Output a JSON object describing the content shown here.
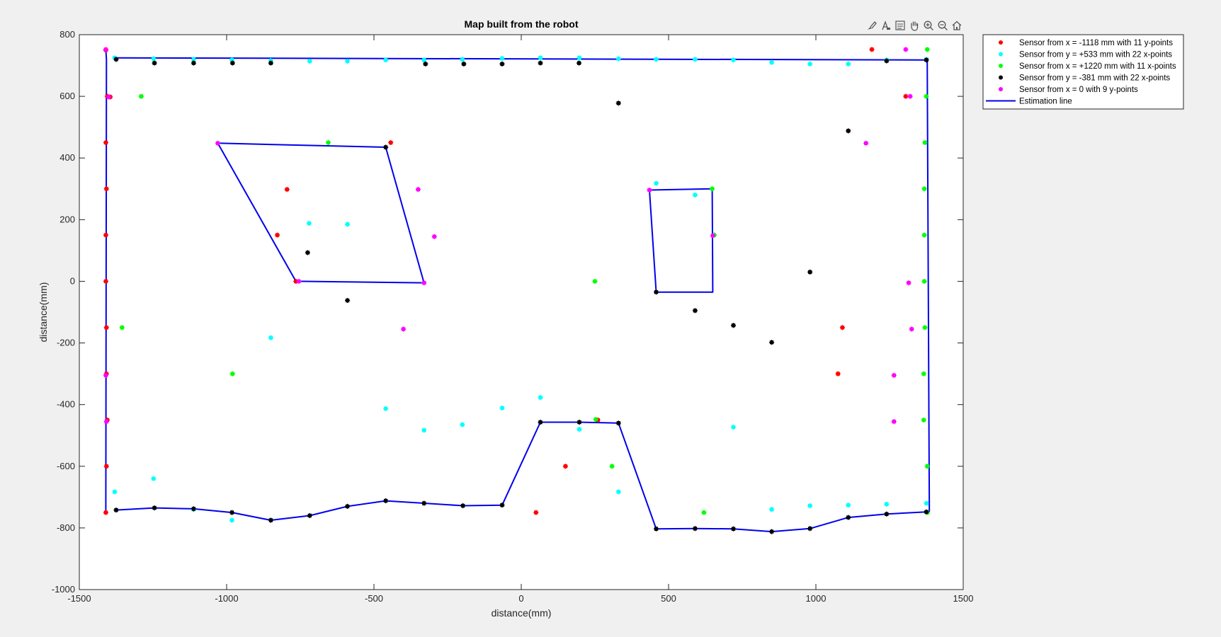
{
  "chart_data": {
    "type": "scatter",
    "title": "Map built from the robot",
    "xlabel": "distance(mm)",
    "ylabel": "distance(mm)",
    "xlim": [
      -1500,
      1500
    ],
    "ylim": [
      -1000,
      800
    ],
    "xticks": [
      -1500,
      -1000,
      -500,
      0,
      500,
      1000,
      1500
    ],
    "yticks": [
      -1000,
      -800,
      -600,
      -400,
      -200,
      0,
      200,
      400,
      600,
      800
    ],
    "xticklabels": [
      "-1500",
      "-1000",
      "-500",
      "0",
      "500",
      "1000",
      "1500"
    ],
    "yticklabels": [
      "-1000",
      "-800",
      "-600",
      "-400",
      "-200",
      "0",
      "200",
      "400",
      "600",
      "800"
    ],
    "grid": false,
    "legend_position": "outside-top-right",
    "series": [
      {
        "name": "Sensor from x = -1118 mm with 11 y-points",
        "kind": "scatter",
        "color": "#ff0000",
        "points": [
          [
            -1410,
            750
          ],
          [
            -1405,
            600
          ],
          [
            -1410,
            450
          ],
          [
            -1408,
            300
          ],
          [
            -1410,
            150
          ],
          [
            -1410,
            0
          ],
          [
            -1408,
            -150
          ],
          [
            -1408,
            -300
          ],
          [
            -1405,
            -450
          ],
          [
            -1408,
            -600
          ],
          [
            -1410,
            -750
          ],
          [
            -795,
            298
          ],
          [
            -828,
            150
          ],
          [
            -765,
            0
          ],
          [
            -443,
            450
          ],
          [
            -1395,
            598
          ],
          [
            1190,
            752
          ],
          [
            1305,
            600
          ],
          [
            1090,
            -150
          ],
          [
            1075,
            -300
          ],
          [
            260,
            -450
          ],
          [
            150,
            -600
          ],
          [
            50,
            -750
          ]
        ]
      },
      {
        "name": "Sensor from y = +533 mm with 22 x-points",
        "kind": "scatter",
        "color": "#00ffff",
        "points": [
          [
            -1380,
            725
          ],
          [
            -1248,
            722
          ],
          [
            -1112,
            720
          ],
          [
            -982,
            718
          ],
          [
            -850,
            716
          ],
          [
            -718,
            714
          ],
          [
            -590,
            714
          ],
          [
            -460,
            718
          ],
          [
            -330,
            718
          ],
          [
            -200,
            720
          ],
          [
            -65,
            723
          ],
          [
            65,
            725
          ],
          [
            197,
            725
          ],
          [
            330,
            722
          ],
          [
            458,
            720
          ],
          [
            590,
            720
          ],
          [
            720,
            718
          ],
          [
            850,
            710
          ],
          [
            980,
            705
          ],
          [
            1110,
            705
          ],
          [
            1240,
            718
          ],
          [
            1375,
            720
          ],
          [
            -720,
            188
          ],
          [
            -590,
            185
          ],
          [
            -850,
            -183
          ],
          [
            -460,
            -413
          ],
          [
            -330,
            -483
          ],
          [
            -200,
            -465
          ],
          [
            -65,
            -411
          ],
          [
            65,
            -377
          ],
          [
            197,
            -480
          ],
          [
            330,
            -683
          ],
          [
            458,
            318
          ],
          [
            590,
            280
          ],
          [
            720,
            -473
          ],
          [
            850,
            -740
          ],
          [
            980,
            -728
          ],
          [
            1110,
            -726
          ],
          [
            1240,
            -723
          ],
          [
            1375,
            -720
          ],
          [
            -1380,
            -683
          ],
          [
            -1248,
            -640
          ],
          [
            -1112,
            -740
          ],
          [
            -982,
            -775
          ]
        ]
      },
      {
        "name": "Sensor from x = +1220 mm with 11 x-points",
        "kind": "scatter",
        "color": "#00ff00",
        "points": [
          [
            1378,
            752
          ],
          [
            1375,
            600
          ],
          [
            1370,
            450
          ],
          [
            1368,
            300
          ],
          [
            1368,
            150
          ],
          [
            1368,
            0
          ],
          [
            1370,
            -150
          ],
          [
            1366,
            -300
          ],
          [
            1366,
            -450
          ],
          [
            1378,
            -600
          ],
          [
            1378,
            -750
          ],
          [
            -1290,
            600
          ],
          [
            -1355,
            -150
          ],
          [
            -980,
            -300
          ],
          [
            -655,
            450
          ],
          [
            250,
            0
          ],
          [
            655,
            150
          ],
          [
            648,
            300
          ],
          [
            308,
            -600
          ],
          [
            620,
            -750
          ],
          [
            253,
            -448
          ]
        ]
      },
      {
        "name": "Sensor from y = -381 mm with 22 x-points",
        "kind": "scatter",
        "color": "#000000",
        "points": [
          [
            -1375,
            720
          ],
          [
            -1245,
            708
          ],
          [
            -1112,
            708
          ],
          [
            -980,
            708
          ],
          [
            -850,
            708
          ],
          [
            -325,
            705
          ],
          [
            -195,
            705
          ],
          [
            -65,
            705
          ],
          [
            65,
            708
          ],
          [
            196,
            708
          ],
          [
            330,
            578
          ],
          [
            1110,
            488
          ],
          [
            1240,
            715
          ],
          [
            1375,
            718
          ],
          [
            -725,
            93
          ],
          [
            -590,
            -62
          ],
          [
            -460,
            435
          ],
          [
            590,
            -95
          ],
          [
            720,
            -143
          ],
          [
            850,
            -198
          ],
          [
            980,
            30
          ],
          [
            458,
            -35
          ],
          [
            -1375,
            -742
          ],
          [
            -1245,
            -735
          ],
          [
            -1112,
            -738
          ],
          [
            -982,
            -750
          ],
          [
            -850,
            -775
          ],
          [
            -718,
            -760
          ],
          [
            -590,
            -730
          ],
          [
            -460,
            -712
          ],
          [
            -330,
            -720
          ],
          [
            -198,
            -728
          ],
          [
            -65,
            -726
          ],
          [
            65,
            -457
          ],
          [
            197,
            -457
          ],
          [
            330,
            -460
          ],
          [
            458,
            -803
          ],
          [
            590,
            -802
          ],
          [
            720,
            -803
          ],
          [
            850,
            -812
          ],
          [
            980,
            -802
          ],
          [
            1110,
            -766
          ],
          [
            1240,
            -755
          ],
          [
            1375,
            -748
          ]
        ]
      },
      {
        "name": "Sensor from x = 0 with 9 y-points",
        "kind": "scatter",
        "color": "#ff00ff",
        "points": [
          [
            -1410,
            752
          ],
          [
            -1400,
            598
          ],
          [
            -1410,
            -305
          ],
          [
            -1408,
            -455
          ],
          [
            -1030,
            448
          ],
          [
            -755,
            0
          ],
          [
            -350,
            298
          ],
          [
            -295,
            145
          ],
          [
            -330,
            -5
          ],
          [
            -400,
            -155
          ],
          [
            435,
            296
          ],
          [
            650,
            148
          ],
          [
            1170,
            448
          ],
          [
            1320,
            600
          ],
          [
            1305,
            752
          ],
          [
            1315,
            -5
          ],
          [
            1325,
            -155
          ],
          [
            1265,
            -305
          ],
          [
            1265,
            -455
          ]
        ]
      },
      {
        "name": "Estimation line",
        "kind": "line",
        "color": "#0000ee",
        "segments": [
          [
            [
              -1378,
              725
            ],
            [
              1375,
              718
            ]
          ],
          [
            [
              -1410,
              752
            ],
            [
              -1408,
              720
            ],
            [
              -1410,
              -750
            ]
          ],
          [
            [
              1378,
              720
            ],
            [
              1385,
              -748
            ]
          ],
          [
            [
              -1375,
              -742
            ],
            [
              -1245,
              -735
            ],
            [
              -1112,
              -738
            ],
            [
              -982,
              -750
            ],
            [
              -850,
              -775
            ],
            [
              -718,
              -760
            ],
            [
              -590,
              -730
            ],
            [
              -460,
              -712
            ],
            [
              -330,
              -720
            ],
            [
              -198,
              -728
            ],
            [
              -65,
              -726
            ],
            [
              65,
              -457
            ],
            [
              197,
              -457
            ],
            [
              330,
              -460
            ],
            [
              458,
              -803
            ],
            [
              590,
              -802
            ],
            [
              720,
              -803
            ],
            [
              850,
              -812
            ],
            [
              980,
              -802
            ],
            [
              1110,
              -766
            ],
            [
              1240,
              -755
            ],
            [
              1375,
              -748
            ]
          ],
          [
            [
              -1030,
              448
            ],
            [
              -460,
              435
            ],
            [
              -330,
              -5
            ],
            [
              -765,
              0
            ],
            [
              -1030,
              448
            ]
          ],
          [
            [
              435,
              296
            ],
            [
              648,
              300
            ],
            [
              650,
              -35
            ],
            [
              458,
              -35
            ],
            [
              435,
              296
            ]
          ]
        ]
      }
    ]
  },
  "toolbar": {
    "icons": [
      "brush-icon",
      "data-cursor-icon",
      "legend-toggle-icon",
      "pan-hand-icon",
      "zoom-in-icon",
      "zoom-out-icon",
      "home-icon"
    ]
  }
}
